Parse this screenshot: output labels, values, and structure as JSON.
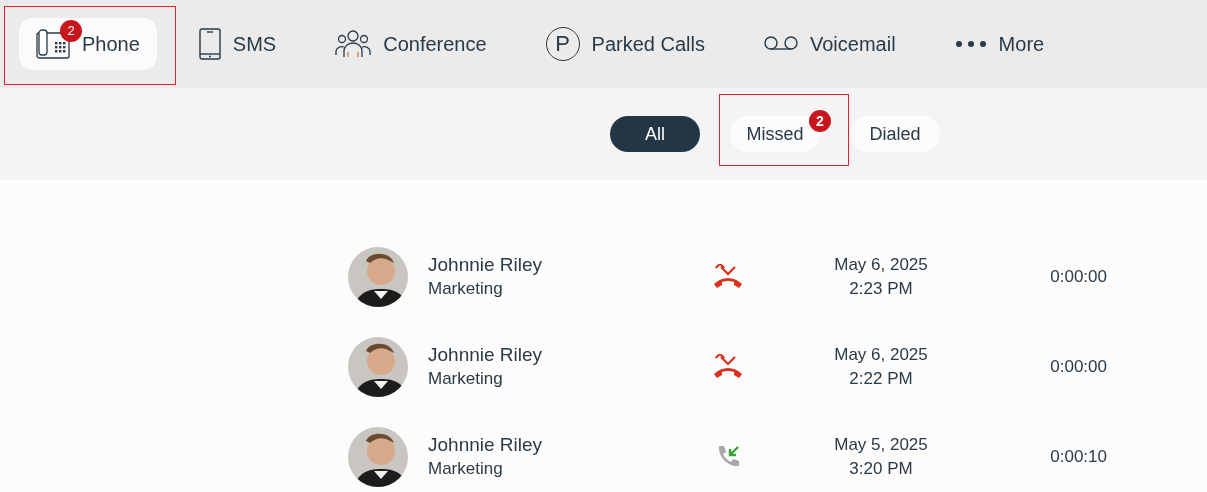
{
  "tabs": [
    {
      "kind": "phone",
      "label": "Phone",
      "selected": true,
      "highlighted": true,
      "badge": "2"
    },
    {
      "kind": "sms",
      "label": "SMS",
      "selected": false,
      "highlighted": false
    },
    {
      "kind": "conference",
      "label": "Conference",
      "selected": false,
      "highlighted": false
    },
    {
      "kind": "parked",
      "label": "Parked Calls",
      "selected": false,
      "highlighted": false,
      "icon_text": "P"
    },
    {
      "kind": "voicemail",
      "label": "Voicemail",
      "selected": false,
      "highlighted": false
    },
    {
      "kind": "more",
      "label": "More",
      "selected": false,
      "highlighted": false
    }
  ],
  "filters": [
    {
      "label": "All",
      "selected": true,
      "highlighted": false
    },
    {
      "label": "Missed",
      "selected": false,
      "highlighted": true,
      "badge": "2"
    },
    {
      "label": "Dialed",
      "selected": false,
      "highlighted": false
    }
  ],
  "calls": [
    {
      "name": "Johnnie Riley",
      "department": "Marketing",
      "kind": "missed",
      "date": "May 6, 2025",
      "time": "2:23 PM",
      "duration": "0:00:00"
    },
    {
      "name": "Johnnie Riley",
      "department": "Marketing",
      "kind": "missed",
      "date": "May 6, 2025",
      "time": "2:22 PM",
      "duration": "0:00:00"
    },
    {
      "name": "Johnnie Riley",
      "department": "Marketing",
      "kind": "incoming",
      "date": "May 5, 2025",
      "time": "3:20 PM",
      "duration": "0:00:10"
    }
  ]
}
